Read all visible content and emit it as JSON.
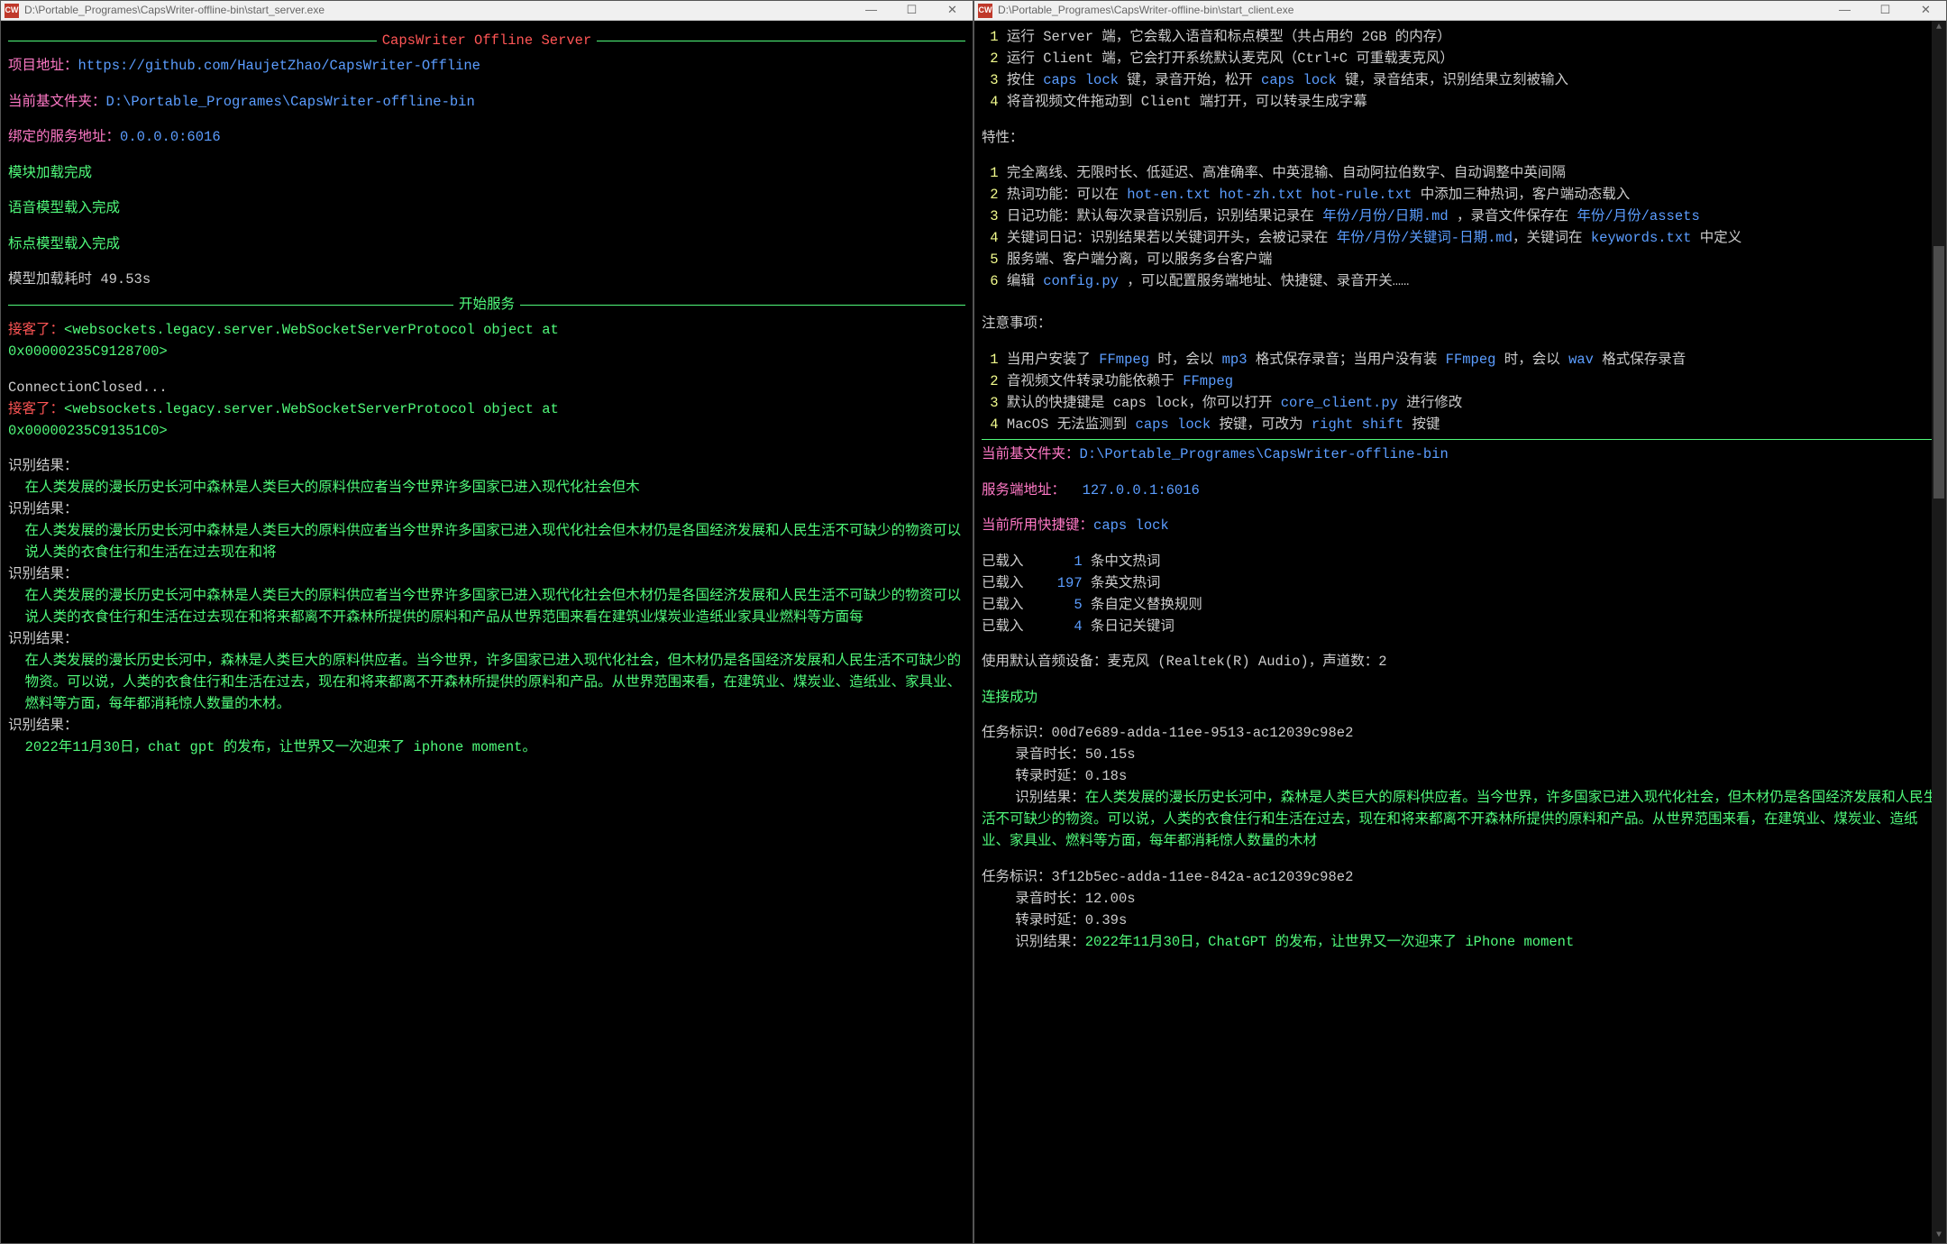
{
  "left": {
    "title": "D:\\Portable_Programes\\CapsWriter-offline-bin\\start_server.exe",
    "icon": "CW",
    "banner": "CapsWriter Offline Server",
    "proj_label": "项目地址：",
    "proj_url": "https://github.com/HaujetZhao/CapsWriter-Offline",
    "folder_label": "当前基文件夹：",
    "folder_path": "D:\\Portable_Programes\\CapsWriter-offline-bin",
    "bind_label": "绑定的服务地址：",
    "bind_addr": "0.0.0.0:6016",
    "loaded_modules": "模块加载完成",
    "loaded_speech": "语音模型载入完成",
    "loaded_punct": "标点模型载入完成",
    "model_time_label": "模型加载耗时",
    "model_time_val": " 49.53s",
    "start_service": "开始服务",
    "accepted": "接客了：",
    "ws1a": "<websockets.legacy.server.WebSocketServerProtocol object at",
    "ws1b": "0x00000235C9128700>",
    "conn_closed": "ConnectionClosed...",
    "ws2a": "<websockets.legacy.server.WebSocketServerProtocol object at",
    "ws2b": "0x00000235C91351C0>",
    "result_label": "识别结果：",
    "r1": "在人类发展的漫长历史长河中森林是人类巨大的原料供应者当今世界许多国家已进入现代化社会但木",
    "r2": "在人类发展的漫长历史长河中森林是人类巨大的原料供应者当今世界许多国家已进入现代化社会但木材仍是各国经济发展和人民生活不可缺少的物资可以说人类的衣食住行和生活在过去现在和将",
    "r3": "在人类发展的漫长历史长河中森林是人类巨大的原料供应者当今世界许多国家已进入现代化社会但木材仍是各国经济发展和人民生活不可缺少的物资可以说人类的衣食住行和生活在过去现在和将来都离不开森林所提供的原料和产品从世界范围来看在建筑业煤炭业造纸业家具业燃料等方面每",
    "r4": "在人类发展的漫长历史长河中，森林是人类巨大的原料供应者。当今世界，许多国家已进入现代化社会，但木材仍是各国经济发展和人民生活不可缺少的物资。可以说，人类的衣食住行和生活在过去，现在和将来都离不开森林所提供的原料和产品。从世界范围来看，在建筑业、煤炭业、造纸业、家具业、燃料等方面，每年都消耗惊人数量的木材。",
    "r5": "2022年11月30日，chat gpt 的发布，让世界又一次迎来了 iphone moment。"
  },
  "right": {
    "title": "D:\\Portable_Programes\\CapsWriter-offline-bin\\start_client.exe",
    "icon": "CW",
    "steps": [
      "运行 Server 端，它会载入语音和标点模型（共占用约 2GB 的内存）",
      "运行 Client 端，它会打开系统默认麦克风（Ctrl+C 可重载麦克风）"
    ],
    "step3_a": "按住 ",
    "step3_caps1": "caps lock",
    "step3_b": " 键，录音开始，松开 ",
    "step3_caps2": "caps lock",
    "step3_c": " 键，录音结束，识别结果立刻被输入",
    "step4": "将音视频文件拖动到 Client 端打开，可以转录生成字幕",
    "features_label": "特性：",
    "f1": "完全离线、无限时长、低延迟、高准确率、中英混输、自动阿拉伯数字、自动调整中英间隔",
    "f2_a": "热词功能：可以在 ",
    "f2_files": "hot-en.txt hot-zh.txt hot-rule.txt",
    "f2_b": " 中添加三种热词，客户端动态载入",
    "f3_a": "日记功能：默认每次录音识别后，识别结果记录在 ",
    "f3_path": "年份/月份/日期.md",
    "f3_b": " ，录音文件保存在 ",
    "f3_path2": "年份/月份/assets",
    "f4_a": "关键词日记：识别结果若以关键词开头，会被记录在 ",
    "f4_path": "年份/月份/关键词-日期.md",
    "f4_b": "，关键词在 ",
    "f4_path2": "keywords.txt",
    "f4_c": " 中定义",
    "f5": "服务端、客户端分离，可以服务多台客户端",
    "f6_a": "编辑 ",
    "f6_file": "config.py",
    "f6_b": " ，可以配置服务端地址、快捷键、录音开关……",
    "notes_label": "注意事项：",
    "n1_a": "当用户安装了 ",
    "n1_ff1": "FFmpeg",
    "n1_b": " 时，会以 ",
    "n1_mp3": "mp3",
    "n1_c": " 格式保存录音；当用户没有装 ",
    "n1_ff2": "FFmpeg",
    "n1_d": " 时，会以 ",
    "n1_wav": "wav",
    "n1_e": " 格式保存录音",
    "n2_a": "音视频文件转录功能依赖于 ",
    "n2_ff": "FFmpeg",
    "n3_a": "默认的快捷键是 ",
    "n3_caps": "caps lock",
    "n3_b": "，你可以打开 ",
    "n3_file": "core_client.py",
    "n3_c": " 进行修改",
    "n4_a": "MacOS 无法监测到 ",
    "n4_caps": "caps lock",
    "n4_b": " 按键，可改为 ",
    "n4_rs": "right shift",
    "n4_c": " 按键",
    "folder_label": "当前基文件夹：",
    "folder_path": "D:\\Portable_Programes\\CapsWriter-offline-bin",
    "server_addr_label": "服务端地址：",
    "server_addr": "  127.0.0.1:6016",
    "hotkey_label": "当前所用快捷键：",
    "hotkey": "caps lock",
    "loaded_prefix": "已载入 ",
    "cn_hot_n": "     1",
    "cn_hot": " 条中文热词",
    "en_hot_n": "   197",
    "en_hot": " 条英文热词",
    "rule_n": "     5",
    "rule": " 条自定义替换规则",
    "kw_n": "     4",
    "kw": " 条日记关键词",
    "audio_dev": "使用默认音频设备：麦克风 (Realtek(R) Audio)，声道数：2",
    "conn_ok": "连接成功",
    "task1_id_label": "任务标识：",
    "task1_id": "00d7e689-adda-11ee-9513-ac12039c98e2",
    "rec_len_label": "    录音时长：",
    "task1_rec": "50.15s",
    "trans_delay_label": "    转录时延：",
    "task1_delay": "0.18s",
    "task_result_label": "    识别结果：",
    "task1_result": "在人类发展的漫长历史长河中，森林是人类巨大的原料供应者。当今世界，许多国家已进入现代化社会，但木材仍是各国经济发展和人民生活不可缺少的物资。可以说，人类的衣食住行和生活在过去，现在和将来都离不开森林所提供的原料和产品。从世界范围来看，在建筑业、煤炭业、造纸业、家具业、燃料等方面，每年都消耗惊人数量的木材",
    "task2_id": "3f12b5ec-adda-11ee-842a-ac12039c98e2",
    "task2_rec": "12.00s",
    "task2_delay": "0.39s",
    "task2_result": "2022年11月30日，ChatGPT 的发布，让世界又一次迎来了 iPhone moment"
  },
  "winbtn": {
    "min": "—",
    "max": "☐",
    "close": "✕"
  }
}
